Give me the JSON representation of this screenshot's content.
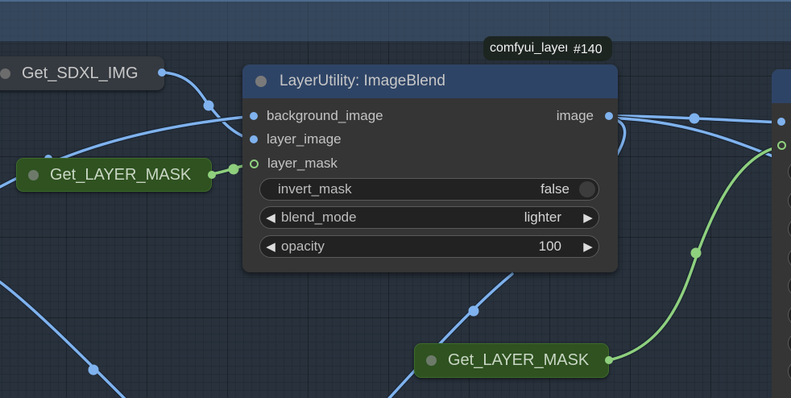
{
  "nodes": {
    "get_sdxl_img": {
      "label": "Get_SDXL_IMG"
    },
    "get_layer_mask_left": {
      "label": "Get_LAYER_MASK"
    },
    "get_layer_mask_bottom": {
      "label": "Get_LAYER_MASK"
    },
    "image_blend": {
      "title": "LayerUtility: ImageBlend",
      "badge_name": "comfyui_layerstyle",
      "badge_id": "#140",
      "inputs": [
        "background_image",
        "layer_image",
        "layer_mask"
      ],
      "output": "image",
      "widgets": {
        "invert_mask": {
          "label": "invert_mask",
          "value": "false"
        },
        "blend_mode": {
          "label": "blend_mode",
          "value": "lighter"
        },
        "opacity": {
          "label": "opacity",
          "value": "100"
        }
      }
    }
  },
  "colors": {
    "image_link": "#7fb2ee",
    "mask_link": "#8fd07e",
    "node_title": "#2e4466",
    "node_body": "#353535",
    "get_node_green": "#2f5220"
  }
}
